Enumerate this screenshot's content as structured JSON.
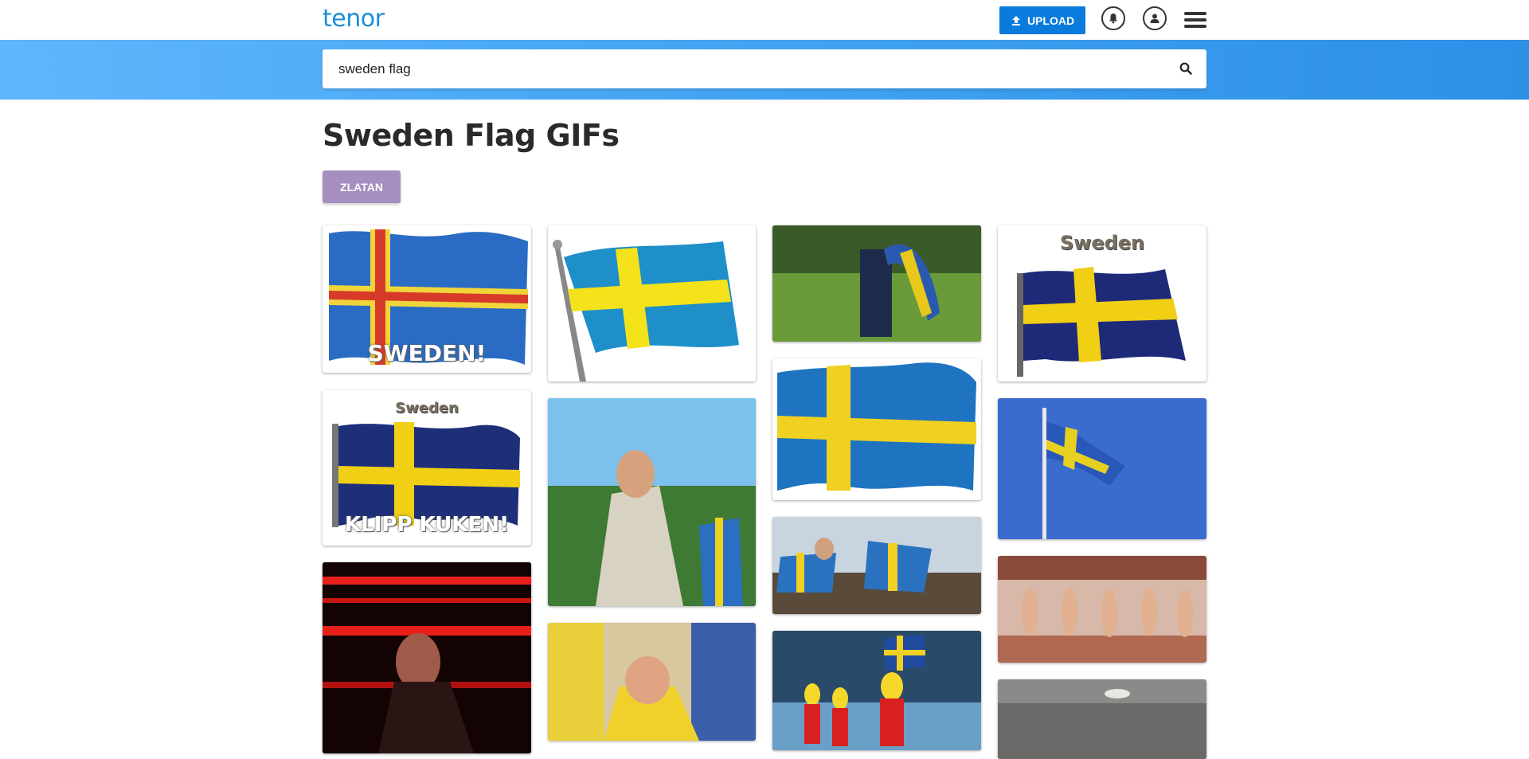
{
  "header": {
    "logo": "tenor",
    "upload_label": "UPLOAD",
    "upload_icon": "upload-arrow-icon",
    "notifications_icon": "bell-icon",
    "profile_icon": "user-icon",
    "menu_icon": "hamburger-menu-icon"
  },
  "search": {
    "value": "sweden flag",
    "search_icon": "search-icon"
  },
  "page": {
    "title": "Sweden Flag GIFs",
    "tags": [
      "ZLATAN"
    ]
  },
  "gifs": [
    {
      "caption": "SWEDEN!"
    },
    {
      "caption": "Sweden",
      "caption_bottom": "KLIPP KUKEN!"
    },
    {
      "caption": "Sweden"
    }
  ],
  "colors": {
    "brand": "#1a8fd6",
    "upload_button": "#0a7bdc",
    "tag_button": "#a58ec0",
    "flag_blue": "#1f5fa8",
    "flag_yellow": "#f3d21a"
  }
}
